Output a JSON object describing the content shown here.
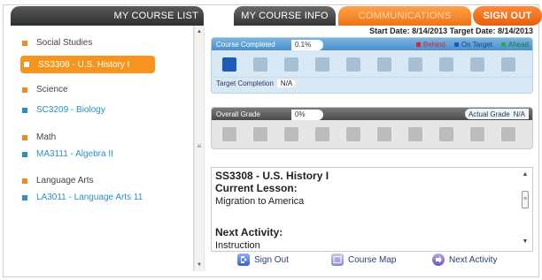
{
  "tabs": {
    "my_course_list": "MY COURSE LIST",
    "my_course_info": "MY COURSE INFO",
    "communications": "COMMUNICATIONS",
    "sign_out": "SIGN OUT"
  },
  "sidebar": {
    "subjects": [
      {
        "name": "Social Studies",
        "courses": [
          {
            "label": "SS3308 - U.S. History I",
            "selected": true
          }
        ]
      },
      {
        "name": "Science",
        "courses": [
          {
            "label": "SC3209 - Biology",
            "selected": false
          }
        ]
      },
      {
        "name": "Math",
        "courses": [
          {
            "label": "MA3111 - Algebra II",
            "selected": false
          }
        ]
      },
      {
        "name": "Language Arts",
        "courses": [
          {
            "label": "LA3011 - Language Arts 11",
            "selected": false
          }
        ]
      }
    ]
  },
  "dates": {
    "text": "Start Date: 8/14/2013 Target Date: 8/14/2013"
  },
  "progress": {
    "course_completed_label": "Course Completed",
    "course_completed_value": "0.1%",
    "legend": [
      {
        "label": "Behind",
        "color": "#e0242a"
      },
      {
        "label": "On Target",
        "color": "#1e5bb8"
      },
      {
        "label": "Ahead",
        "color": "#2ea84a"
      }
    ],
    "squares_total": 10,
    "squares_filled": 1,
    "target_completion_label": "Target Completion",
    "target_completion_value": "N/A"
  },
  "grade": {
    "overall_grade_label": "Overall Grade",
    "overall_grade_value": "0%",
    "actual_grade_label": "Actual Grade",
    "actual_grade_value": "N/A",
    "squares_total": 10
  },
  "lesson": {
    "course_title": "SS3308 - U.S. History I",
    "current_lesson_label": "Current Lesson:",
    "current_lesson_value": "Migration to America",
    "next_activity_label": "Next Activity:",
    "next_activity_value": "Instruction"
  },
  "actions": {
    "sign_out": "Sign Out",
    "course_map": "Course Map",
    "next_activity": "Next Activity"
  },
  "colors": {
    "accent_orange": "#f7941e",
    "link_blue": "#2b8fc4",
    "on_target_blue": "#1e5bb8"
  }
}
